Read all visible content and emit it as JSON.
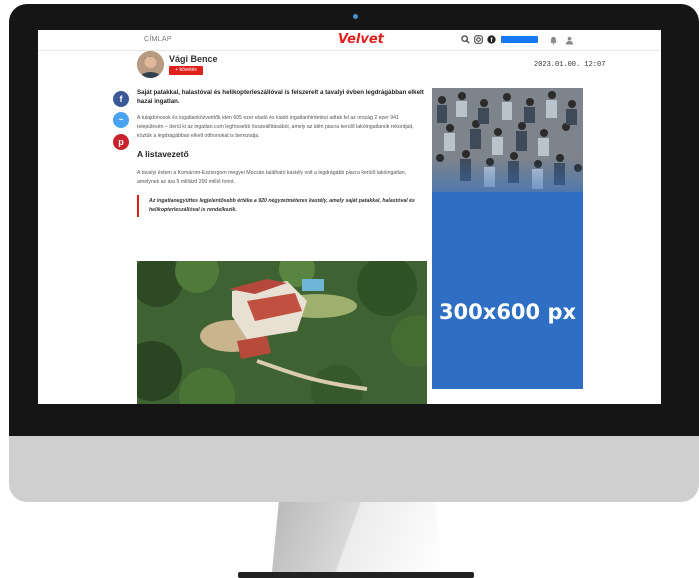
{
  "nav": {
    "home_label": "CÍMLAP"
  },
  "site": {
    "logo_text": "Velvet",
    "brand_color": "#e0201c"
  },
  "header_icons": [
    "search-icon",
    "instagram-icon",
    "facebook-icon",
    "facebook-like-button",
    "bell-icon",
    "user-icon"
  ],
  "author": {
    "name": "Vági Bence",
    "follow_label": "+ követés"
  },
  "article": {
    "date": "2023.01.00. 12:07",
    "lead": "Saját patakkal, halastóval és helikopterleszállóval is felszerelt a tavalyi évben legdrágábban elkelt hazai ingatlan.",
    "paragraph1": "A tulajdonosok és ingatlanközvetítők idén 605 ezer eladó és kiadó ingatlanhirdetést adtak fel az ország 2 ezer 941 településén – derül ki az ingatlan.com legfrissebb összeállításából, amely az idén piacra kerülő lakóingatlanok rekordjait, köztük a legdrágábban elkelt otthonokat is bemutatja.",
    "subheading": "A listavezető",
    "paragraph2": "A tavalyi évben a Komárom-Esztergom megyei Mocsán található kastély volt a legdrágább piacra kerülő lakóingatlan, amelynek az ára 5 milliárd 200 millió forint.",
    "quote": "Az ingatlanegyüttes legjelentősebb értéke a 920 négyzetméteres kastély, amely saját patakkal, halastóval és helikopterleszállóval is rendelkezik."
  },
  "share": [
    "facebook-icon",
    "messenger-icon",
    "pinterest-icon"
  ],
  "ad": {
    "label": "300x600 px"
  }
}
